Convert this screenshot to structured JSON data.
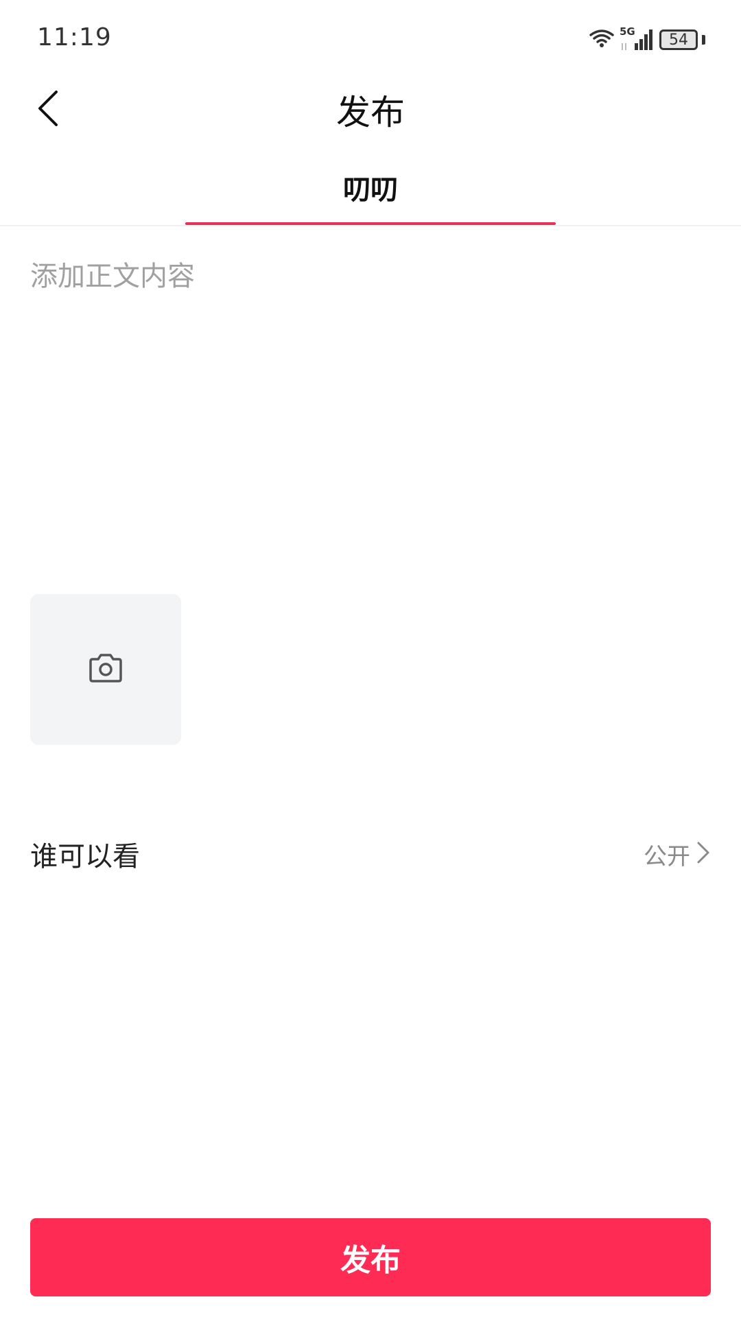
{
  "status_bar": {
    "time": "11:19",
    "network": "5G",
    "battery": "54"
  },
  "header": {
    "title": "发布",
    "back_icon": "chevron-left-icon"
  },
  "tabs": [
    {
      "label": "叨叨",
      "active": true
    }
  ],
  "composer": {
    "placeholder": "添加正文内容",
    "value": "",
    "add_photo_icon": "camera-icon"
  },
  "visibility": {
    "label": "谁可以看",
    "value": "公开"
  },
  "footer": {
    "publish_label": "发布"
  },
  "colors": {
    "accent": "#fe2c55",
    "tab_underline": "#e6315b",
    "photo_tile_bg": "#f3f4f6"
  }
}
